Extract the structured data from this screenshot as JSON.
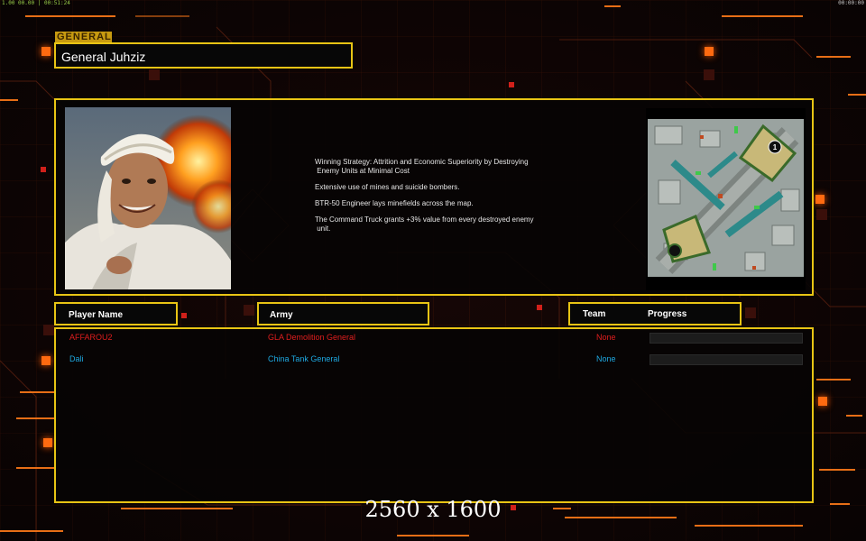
{
  "status": {
    "left": "1.00 00.00 | 00:51:24",
    "right": "00:00:00"
  },
  "general": {
    "tag": "GENERAL",
    "name": "General Juhziz"
  },
  "strategy": [
    "Winning Strategy: Attrition and Economic Superiority by Destroying\n Enemy Units at Minimal Cost",
    "Extensive use of mines and suicide bombers.",
    "BTR-50 Engineer lays minefields across the map.",
    "The Command Truck grants +3% value from every destroyed enemy\n unit."
  ],
  "headers": {
    "player_name": "Player Name",
    "army": "Army",
    "team": "Team",
    "progress": "Progress"
  },
  "players": [
    {
      "name": "AFFAROU2",
      "army": "GLA Demolition General",
      "team": "None",
      "progress": 0,
      "color": "#e01e1e"
    },
    {
      "name": "Dali",
      "army": "China Tank General",
      "team": "None",
      "progress": 0,
      "color": "#1ea8e0"
    }
  ],
  "overlay": {
    "resolution": "2560 x 1600"
  },
  "minimap": {
    "marker_label": "1"
  },
  "colors": {
    "accent": "#e8c414",
    "orange": "#ff7a18"
  }
}
